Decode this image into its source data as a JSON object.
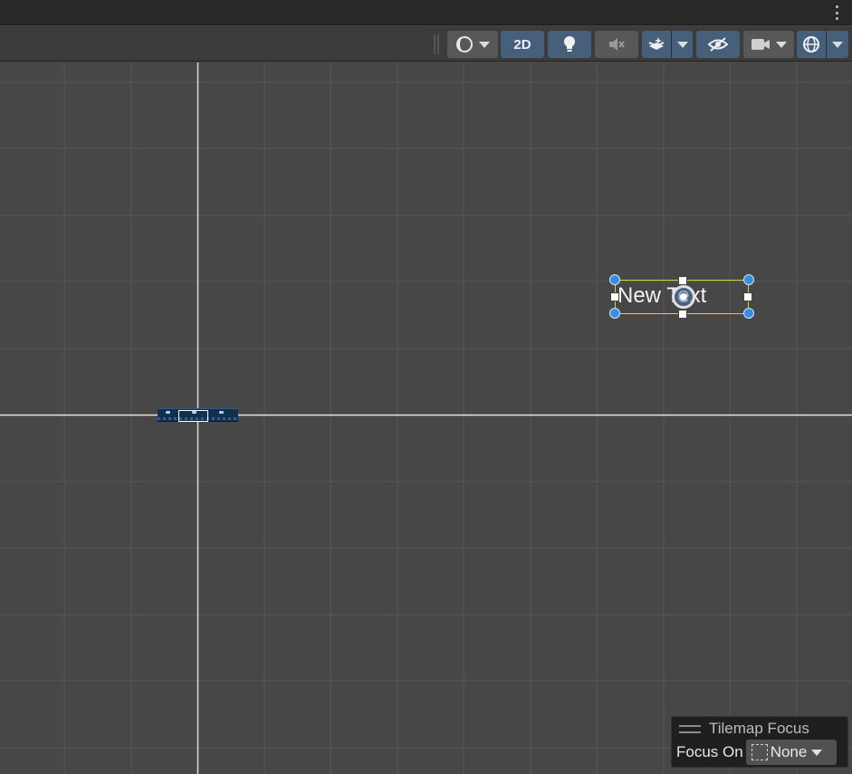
{
  "titlebar": {
    "more_icon": "kebab-menu-icon"
  },
  "toolbar": {
    "shading_icon": "draw-mode-circle-icon",
    "mode_2d_label": "2D",
    "lighting_icon": "lightbulb-icon",
    "audio_icon": "audio-mute-icon",
    "effects_icon": "layers-effects-icon",
    "visibility_icon": "hidden-eye-icon",
    "camera_icon": "camera-icon",
    "gizmos_icon": "gizmo-orbit-icon"
  },
  "scene": {
    "text_object": {
      "text": "New Text"
    }
  },
  "tilemap_focus": {
    "title": "Tilemap Focus",
    "focus_label": "Focus On",
    "selected": "None"
  },
  "colors": {
    "accent_on": "#46607c",
    "handle": "#3a8de0",
    "selection_outline": "#d7d23a"
  }
}
